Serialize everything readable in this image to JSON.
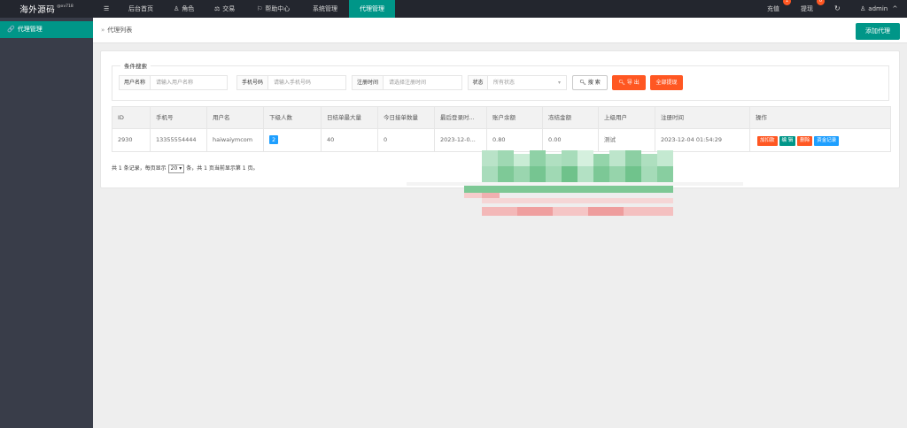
{
  "header": {
    "logo_text": "海外源码",
    "logo_ver": "@xv718",
    "menu_icon": "☰",
    "nav": [
      {
        "icon": "",
        "label": "后台首页"
      },
      {
        "icon": "♙",
        "label": "角色"
      },
      {
        "icon": "⚖",
        "label": "交易"
      },
      {
        "icon": "⚐",
        "label": "帮助中心"
      },
      {
        "icon": "",
        "label": "系统管理"
      },
      {
        "icon": "",
        "label": "代理管理"
      }
    ],
    "recharge": {
      "label": "充值",
      "badge": "1"
    },
    "withdraw": {
      "label": "提现",
      "badge": "0"
    },
    "refresh_icon": "↻",
    "user": {
      "icon": "♙",
      "name": "admin",
      "chevron": "^"
    }
  },
  "sidebar": {
    "items": [
      {
        "icon": "🔗",
        "label": "代理管理"
      }
    ]
  },
  "breadcrumb": {
    "sep": "»",
    "label": "代理列表"
  },
  "add_button": "添加代理",
  "search": {
    "legend": "条件搜索",
    "fields": [
      {
        "label": "用户名称",
        "placeholder": "请输入用户名称"
      },
      {
        "label": "手机号码",
        "placeholder": "请输入手机号码"
      },
      {
        "label": "注册时间",
        "placeholder": "请选择注册时间"
      },
      {
        "label": "状态",
        "placeholder": "所有状态"
      }
    ],
    "search_label": "搜 索",
    "export_label": "导 出",
    "clear_label": "全部提现"
  },
  "table": {
    "headers": [
      "ID",
      "手机号",
      "用户名",
      "下级人数",
      "日结单最大量",
      "今日接单数量",
      "最后登录时...",
      "账户余额",
      "冻结金额",
      "上级用户",
      "注册时间",
      "操作"
    ],
    "rows": [
      {
        "id": "2930",
        "phone": "13355554444",
        "username": "haiwaiymcom",
        "sub_count": "2",
        "daily_max": "40",
        "today_orders": "0",
        "last_login": "2023-12-0...",
        "balance": "0.80",
        "frozen": "0.00",
        "parent": "测试",
        "reg_time": "2023-12-04 01:54:29",
        "ops": [
          "加扣款",
          "编 辑",
          "删除",
          "资金记录"
        ]
      }
    ]
  },
  "pager": {
    "prefix": "共 1 条记录，每页显示",
    "page_size": "20",
    "suffix": "条，共 1 页当前显示第 1 页。"
  }
}
